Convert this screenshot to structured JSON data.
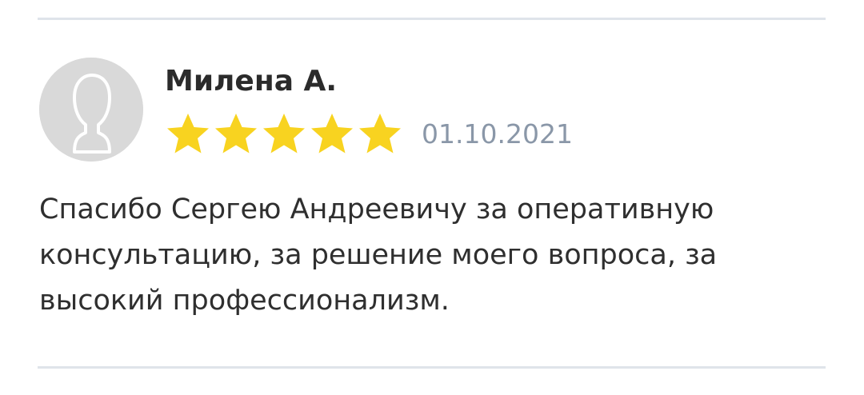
{
  "review": {
    "author": "Милена А.",
    "rating": 5,
    "rating_max": 5,
    "date": "01.10.2021",
    "text": "Спасибо Сергею Андреевичу за оперативную консультацию, за решение моего вопроса, за высокий профессионализм."
  },
  "colors": {
    "star_fill": "#f8d320",
    "divider": "#dfe4ea",
    "avatar_bg": "#d9d9d9",
    "date": "#8a97a8"
  },
  "icons": {
    "avatar": "user-silhouette-icon",
    "star": "star-icon"
  }
}
